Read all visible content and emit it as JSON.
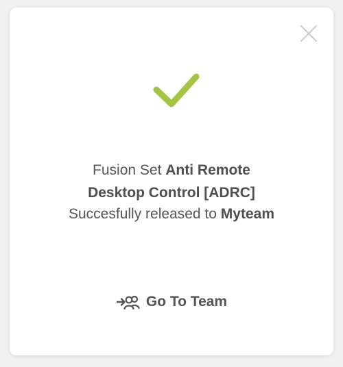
{
  "dialog": {
    "line1_prefix": "Fusion Set ",
    "line1_bold": "Anti Remote",
    "line2_bold": "Desktop Control [ADRC]",
    "line3_prefix": "Succesfully released to ",
    "line3_bold": "Myteam",
    "action_label": "Go To Team"
  },
  "icons": {
    "success": "check-icon",
    "close": "close-icon",
    "team": "team-arrow-icon"
  },
  "colors": {
    "accent": "#a4c443",
    "text": "#555555",
    "close_icon": "#cfcfcf"
  }
}
